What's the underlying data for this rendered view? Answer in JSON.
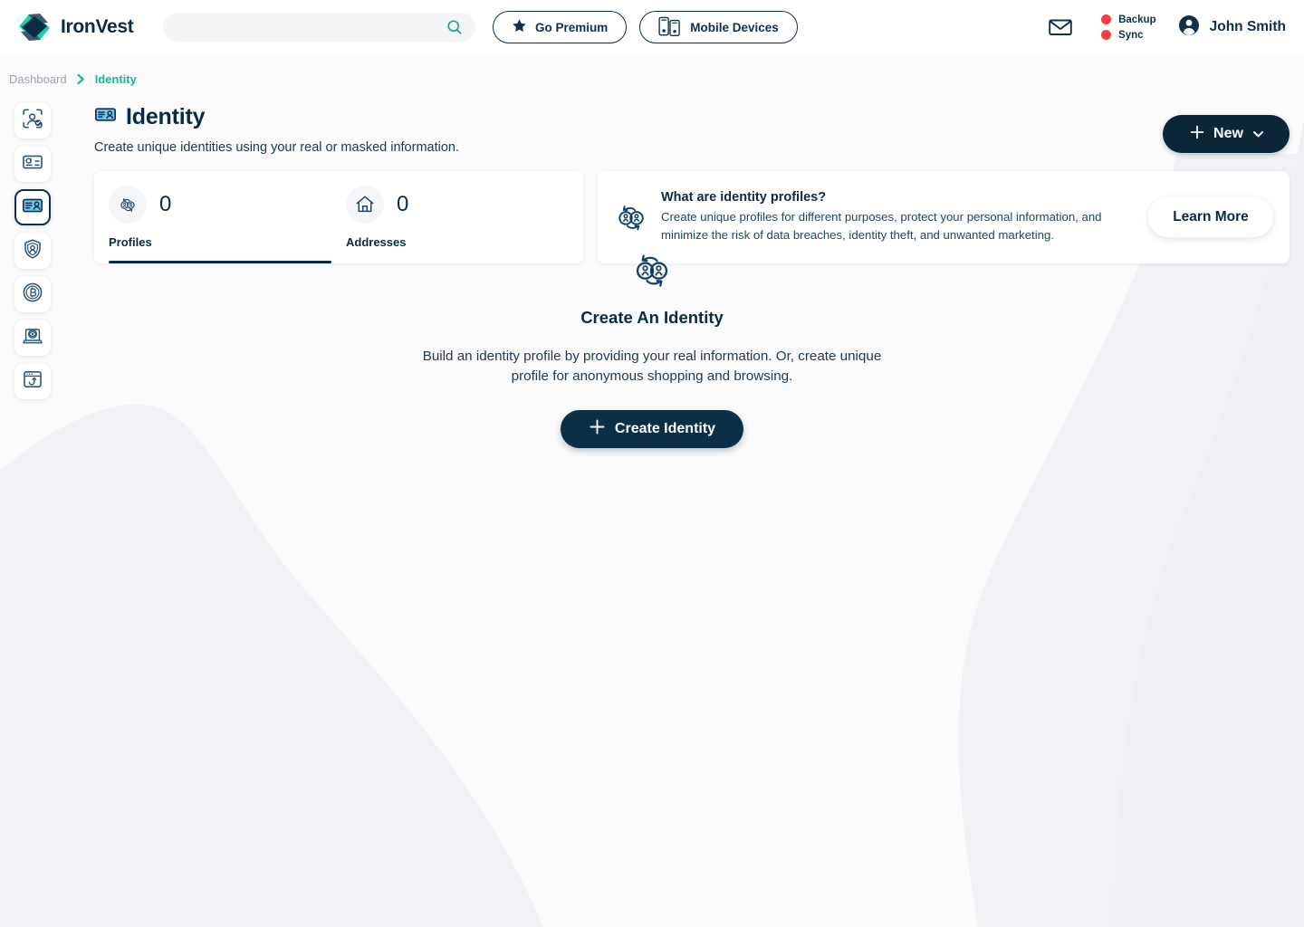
{
  "brand": {
    "name": "IronVest",
    "logo_icon": "ironvest-diamond-logo",
    "accent_teal": "#14b89a",
    "accent_navy": "#0c2b42",
    "status_red": "#f43e3e"
  },
  "header": {
    "search": {
      "value": "",
      "placeholder": "",
      "icon": "search-icon"
    },
    "go_premium": {
      "label": "Go Premium",
      "icon": "star-icon"
    },
    "mobile_devices": {
      "label": "Mobile Devices",
      "icon": "mobile-devices-icon"
    },
    "mail_icon": "mail-icon",
    "statuses": [
      {
        "label": "Backup",
        "color": "#f43e3e"
      },
      {
        "label": "Sync",
        "color": "#f43e3e"
      }
    ],
    "user": {
      "name": "John Smith",
      "avatar_icon": "user-avatar-icon"
    }
  },
  "breadcrumb": {
    "items": [
      {
        "label": "Dashboard",
        "current": false
      },
      {
        "label": "Identity",
        "current": true
      }
    ],
    "separator_icon": "chevron-right-icon"
  },
  "sidebar": {
    "items": [
      {
        "name": "identity-verification",
        "icon": "face-scan-icon",
        "active": false
      },
      {
        "name": "payment-cards",
        "icon": "credit-card-icon",
        "active": false
      },
      {
        "name": "identity",
        "icon": "id-card-icon",
        "active": true
      },
      {
        "name": "security-shield",
        "icon": "shield-user-icon",
        "active": false
      },
      {
        "name": "crypto",
        "icon": "bitcoin-coin-icon",
        "active": false
      },
      {
        "name": "private-browsing",
        "icon": "laptop-eye-icon",
        "active": false
      },
      {
        "name": "phishing-protection",
        "icon": "browser-hook-icon",
        "active": false
      }
    ]
  },
  "page": {
    "icon": "id-card-icon",
    "title": "Identity",
    "subtitle": "Create unique identities using your real or masked information.",
    "new_button": {
      "label": "New",
      "plus_icon": "plus-icon",
      "caret_icon": "chevron-down-icon"
    }
  },
  "stats": {
    "items": [
      {
        "label": "Profiles",
        "value": "0",
        "icon": "profiles-swap-icon",
        "active": true
      },
      {
        "label": "Addresses",
        "value": "0",
        "icon": "home-icon",
        "active": false
      }
    ]
  },
  "info_card": {
    "icon": "profiles-swap-icon",
    "title": "What are identity profiles?",
    "body": "Create unique profiles for different purposes, protect your personal information, and minimize the risk of data breaches, identity theft, and unwanted marketing.",
    "learn_more_label": "Learn More"
  },
  "empty_state": {
    "icon": "profiles-swap-icon",
    "title": "Create An Identity",
    "body": "Build an identity profile by providing your real information. Or, create unique profile for anonymous shopping and browsing.",
    "button": {
      "label": "Create Identity",
      "plus_icon": "plus-icon"
    }
  }
}
